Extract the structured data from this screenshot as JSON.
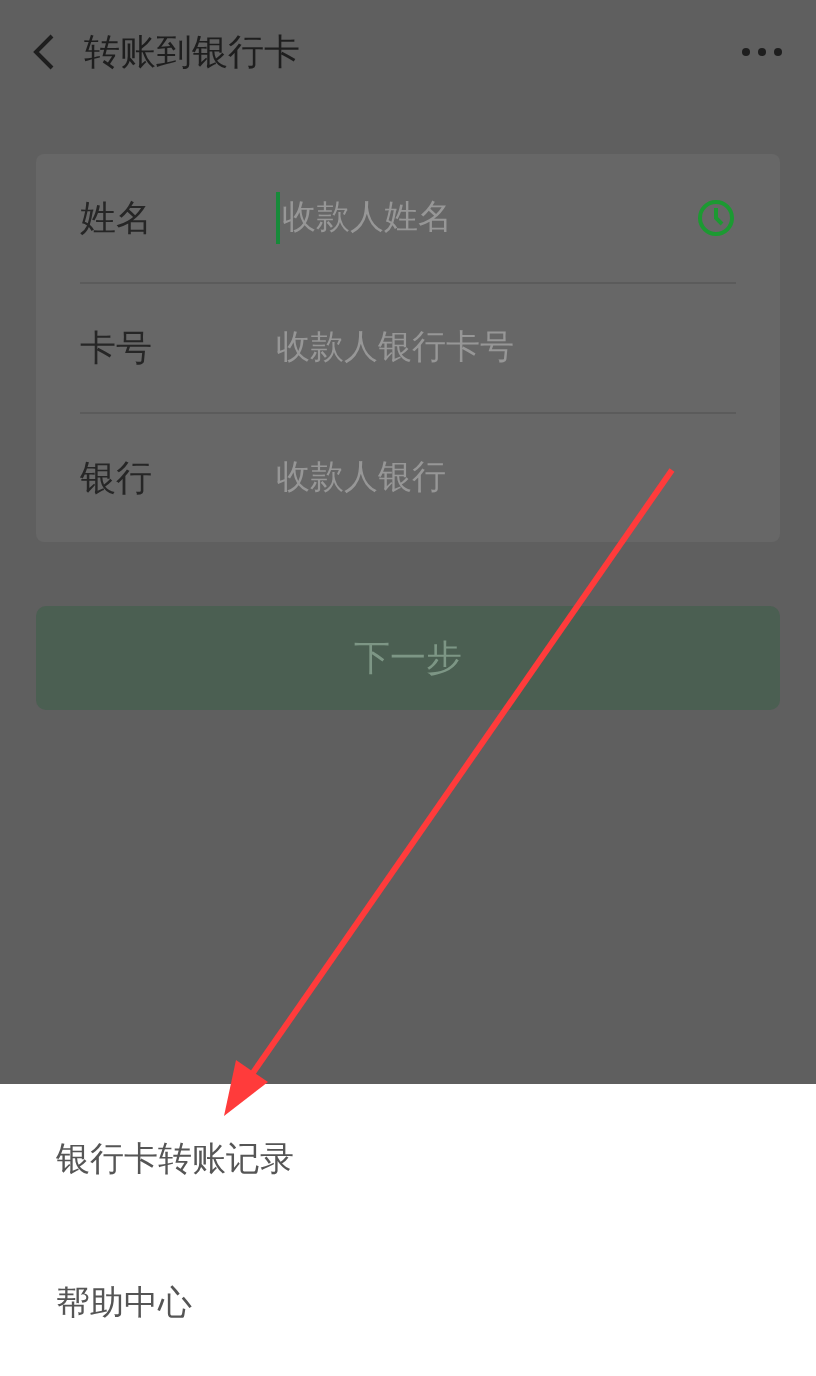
{
  "header": {
    "title": "转账到银行卡"
  },
  "form": {
    "rows": [
      {
        "label": "姓名",
        "placeholder": "收款人姓名",
        "focused": true,
        "kind": "contact"
      },
      {
        "label": "卡号",
        "placeholder": "收款人银行卡号",
        "focused": false,
        "kind": "text"
      },
      {
        "label": "银行",
        "placeholder": "收款人银行",
        "focused": false,
        "kind": "text"
      }
    ]
  },
  "next_button": {
    "label": "下一步",
    "disabled": true
  },
  "action_sheet": {
    "items": [
      "银行卡转账记录",
      "帮助中心"
    ]
  }
}
